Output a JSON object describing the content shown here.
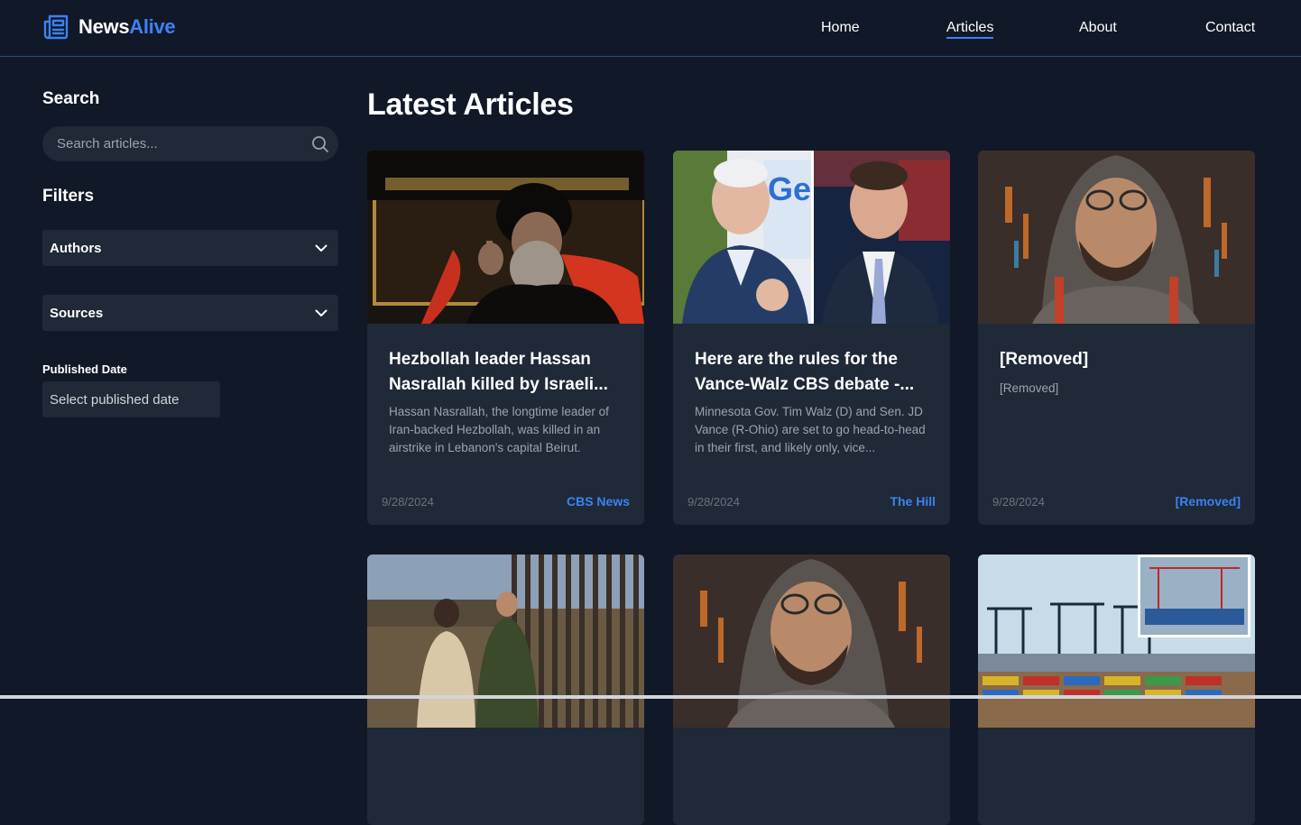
{
  "brand": {
    "name_part1": "News",
    "name_part2": "Alive",
    "accent": "#3b82f6",
    "icon": "newspaper-icon"
  },
  "nav": {
    "links": [
      {
        "label": "Home"
      },
      {
        "label": "Articles",
        "active": true
      },
      {
        "label": "About"
      },
      {
        "label": "Contact"
      }
    ]
  },
  "sidebar": {
    "search_heading": "Search",
    "search_placeholder": "Search articles...",
    "filters_heading": "Filters",
    "authors_label": "Authors",
    "sources_label": "Sources",
    "published_date_label": "Published Date",
    "published_date_placeholder": "Select published date"
  },
  "main": {
    "heading": "Latest Articles",
    "articles": [
      {
        "title": "Hezbollah leader Hassan Nasrallah killed by Israeli...",
        "description": "Hassan Nasrallah, the longtime leader of Iran-backed Hezbollah, was killed in an airstrike in Lebanon's capital Beirut.",
        "date": "9/28/2024",
        "source": "CBS News"
      },
      {
        "title": "Here are the rules for the Vance-Walz CBS debate -...",
        "description": "Minnesota Gov. Tim Walz (D) and Sen. JD Vance (R-Ohio) are set to go head-to-head in their first, and likely only, vice...",
        "date": "9/28/2024",
        "source": "The Hill"
      },
      {
        "title": "[Removed]",
        "description": "[Removed]",
        "date": "9/28/2024",
        "source": "[Removed]"
      },
      {
        "title": "",
        "description": "",
        "date": "",
        "source": ""
      },
      {
        "title": "",
        "description": "",
        "date": "",
        "source": ""
      },
      {
        "title": "",
        "description": "",
        "date": "",
        "source": ""
      }
    ]
  },
  "colors": {
    "background": "#111827",
    "card": "#1f2937",
    "accent": "#3b82f6",
    "muted": "#9ca3af"
  }
}
